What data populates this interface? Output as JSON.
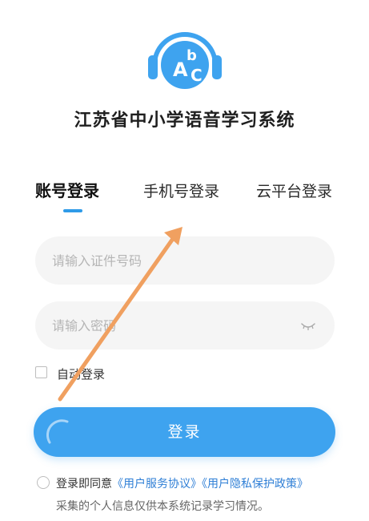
{
  "app": {
    "logo_letter_a": "A",
    "logo_letter_b": "b",
    "logo_letter_c": "C",
    "title": "江苏省中小学语音学习系统"
  },
  "tabs": [
    {
      "label": "账号登录",
      "active": true
    },
    {
      "label": "手机号登录",
      "active": false
    },
    {
      "label": "云平台登录",
      "active": false
    }
  ],
  "form": {
    "id_placeholder": "请输入证件号码",
    "password_placeholder": "请输入密码",
    "auto_login_label": "自动登录",
    "auto_login_checked": false,
    "login_button_label": "登录"
  },
  "agreement": {
    "prefix": "登录即同意",
    "service_link": "《用户服务协议》",
    "privacy_link": "《用户隐私保护政策》",
    "line2": "采集的个人信息仅供本系统记录学习情况。",
    "checked": false
  },
  "colors": {
    "accent": "#3ea3ef",
    "annotation_arrow": "#f0a060"
  },
  "icons": {
    "logo": "headphones-abc-logo",
    "eye": "eye-closed-icon"
  }
}
